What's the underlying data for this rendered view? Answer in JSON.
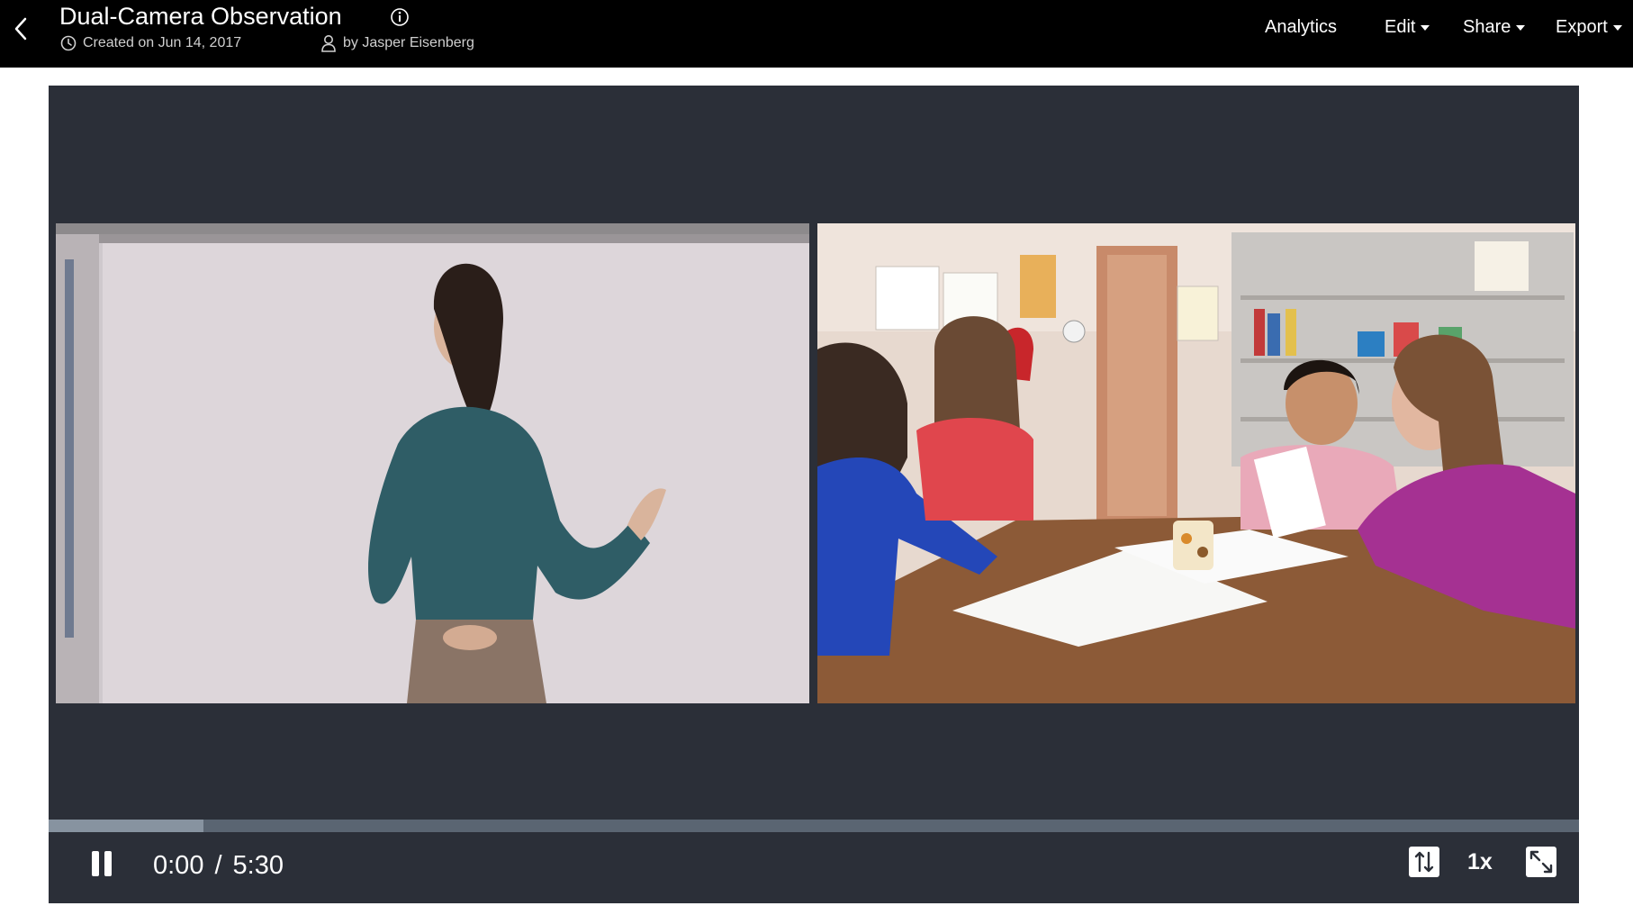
{
  "header": {
    "title": "Dual-Camera Observation",
    "created": "Created on Jun 14, 2017",
    "author": "by Jasper Eisenberg",
    "nav": {
      "analytics": "Analytics",
      "edit": "Edit",
      "share": "Share",
      "export": "Export"
    }
  },
  "player": {
    "current_time": "0:00",
    "separator": "/",
    "duration": "5:30",
    "speed": "1x",
    "buffered_fraction": 0.101,
    "playing": true,
    "left_video_description_icon": "teacher-camera",
    "right_video_description_icon": "students-camera"
  },
  "colors": {
    "header_bg": "#000000",
    "player_bg": "#2b2f38",
    "progress_track": "#5a6572",
    "progress_buffer": "#8793a0"
  }
}
